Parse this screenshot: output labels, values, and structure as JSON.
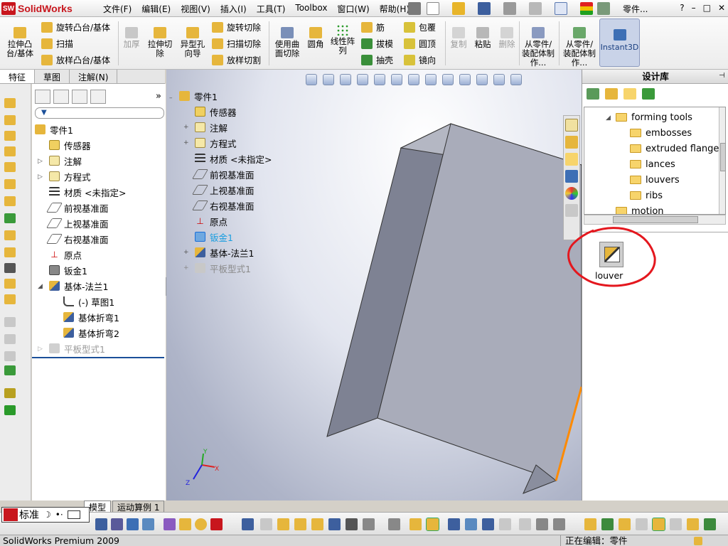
{
  "app": {
    "logo_text": "SolidWorks",
    "logo_mark": "SW"
  },
  "menu": [
    {
      "label": "文件(F)"
    },
    {
      "label": "编辑(E)"
    },
    {
      "label": "视图(V)"
    },
    {
      "label": "插入(I)"
    },
    {
      "label": "工具(T)"
    },
    {
      "label": "Toolbox"
    },
    {
      "label": "窗口(W)"
    },
    {
      "label": "帮助(H)"
    }
  ],
  "titlebar": {
    "doc_name": "零件...",
    "help": "?",
    "min": "–",
    "max": "□",
    "close": "✕"
  },
  "commands": {
    "extrude_boss": "拉伸凸台/基体",
    "revolve_boss": "旋转凸台/基体",
    "sweep": "扫描",
    "loft_boss": "放样凸台/基体",
    "thicken": "加厚",
    "extrude_cut": "拉伸切除",
    "hole_wizard": "异型孔向导",
    "revolve_cut": "旋转切除",
    "swept_cut": "扫描切除",
    "lofted_cut": "放样切割",
    "surface_cut": "使用曲面切除",
    "fillet": "圆角",
    "linear_pattern": "线性阵列",
    "rib": "筋",
    "draft": "拔模",
    "shell": "抽壳",
    "wrap": "包覆",
    "dome": "圆顶",
    "mirror": "镜向",
    "copy": "复制",
    "paste": "粘贴",
    "delete": "删除",
    "from_part": "从零件/装配体制作...",
    "from_part2": "从零件/装配体制作...",
    "instant3d": "Instant3D"
  },
  "tabs": [
    {
      "label": "特征"
    },
    {
      "label": "草图"
    },
    {
      "label": "注解(N)"
    }
  ],
  "feature_tree": [
    {
      "label": "零件1"
    },
    {
      "label": "传感器"
    },
    {
      "label": "注解"
    },
    {
      "label": "方程式"
    },
    {
      "label": "材质 <未指定>"
    },
    {
      "label": "前视基准面"
    },
    {
      "label": "上视基准面"
    },
    {
      "label": "右视基准面"
    },
    {
      "label": "原点"
    },
    {
      "label": "钣金1"
    },
    {
      "label": "基体-法兰1"
    },
    {
      "label": "(-) 草图1"
    },
    {
      "label": "基体折弯1"
    },
    {
      "label": "基体折弯2"
    },
    {
      "label": "平板型式1"
    }
  ],
  "flyout_tree": [
    {
      "label": "零件1"
    },
    {
      "label": "传感器"
    },
    {
      "label": "注解"
    },
    {
      "label": "方程式"
    },
    {
      "label": "材质 <未指定>"
    },
    {
      "label": "前视基准面"
    },
    {
      "label": "上视基准面"
    },
    {
      "label": "右视基准面"
    },
    {
      "label": "原点"
    },
    {
      "label": "钣金1"
    },
    {
      "label": "基体-法兰1"
    },
    {
      "label": "平板型式1"
    }
  ],
  "design_library": {
    "title": "设计库",
    "folders": [
      {
        "label": "forming tools"
      },
      {
        "label": "embosses"
      },
      {
        "label": "extruded flanges"
      },
      {
        "label": "lances"
      },
      {
        "label": "louvers"
      },
      {
        "label": "ribs"
      },
      {
        "label": "motion"
      }
    ],
    "item_label": "louver"
  },
  "bottom_tabs": [
    {
      "label": "模型"
    },
    {
      "label": "运动算例 1"
    }
  ],
  "ime": {
    "label": "标准"
  },
  "status": {
    "left": "SolidWorks Premium 2009",
    "right": "正在编辑：零件"
  },
  "triad": {
    "x": "X",
    "y": "Y",
    "z": "Z"
  },
  "colors": {
    "accent_red": "#e4171e",
    "edge_orange": "#ff8a00",
    "selected_blue": "#1a6fd8"
  }
}
